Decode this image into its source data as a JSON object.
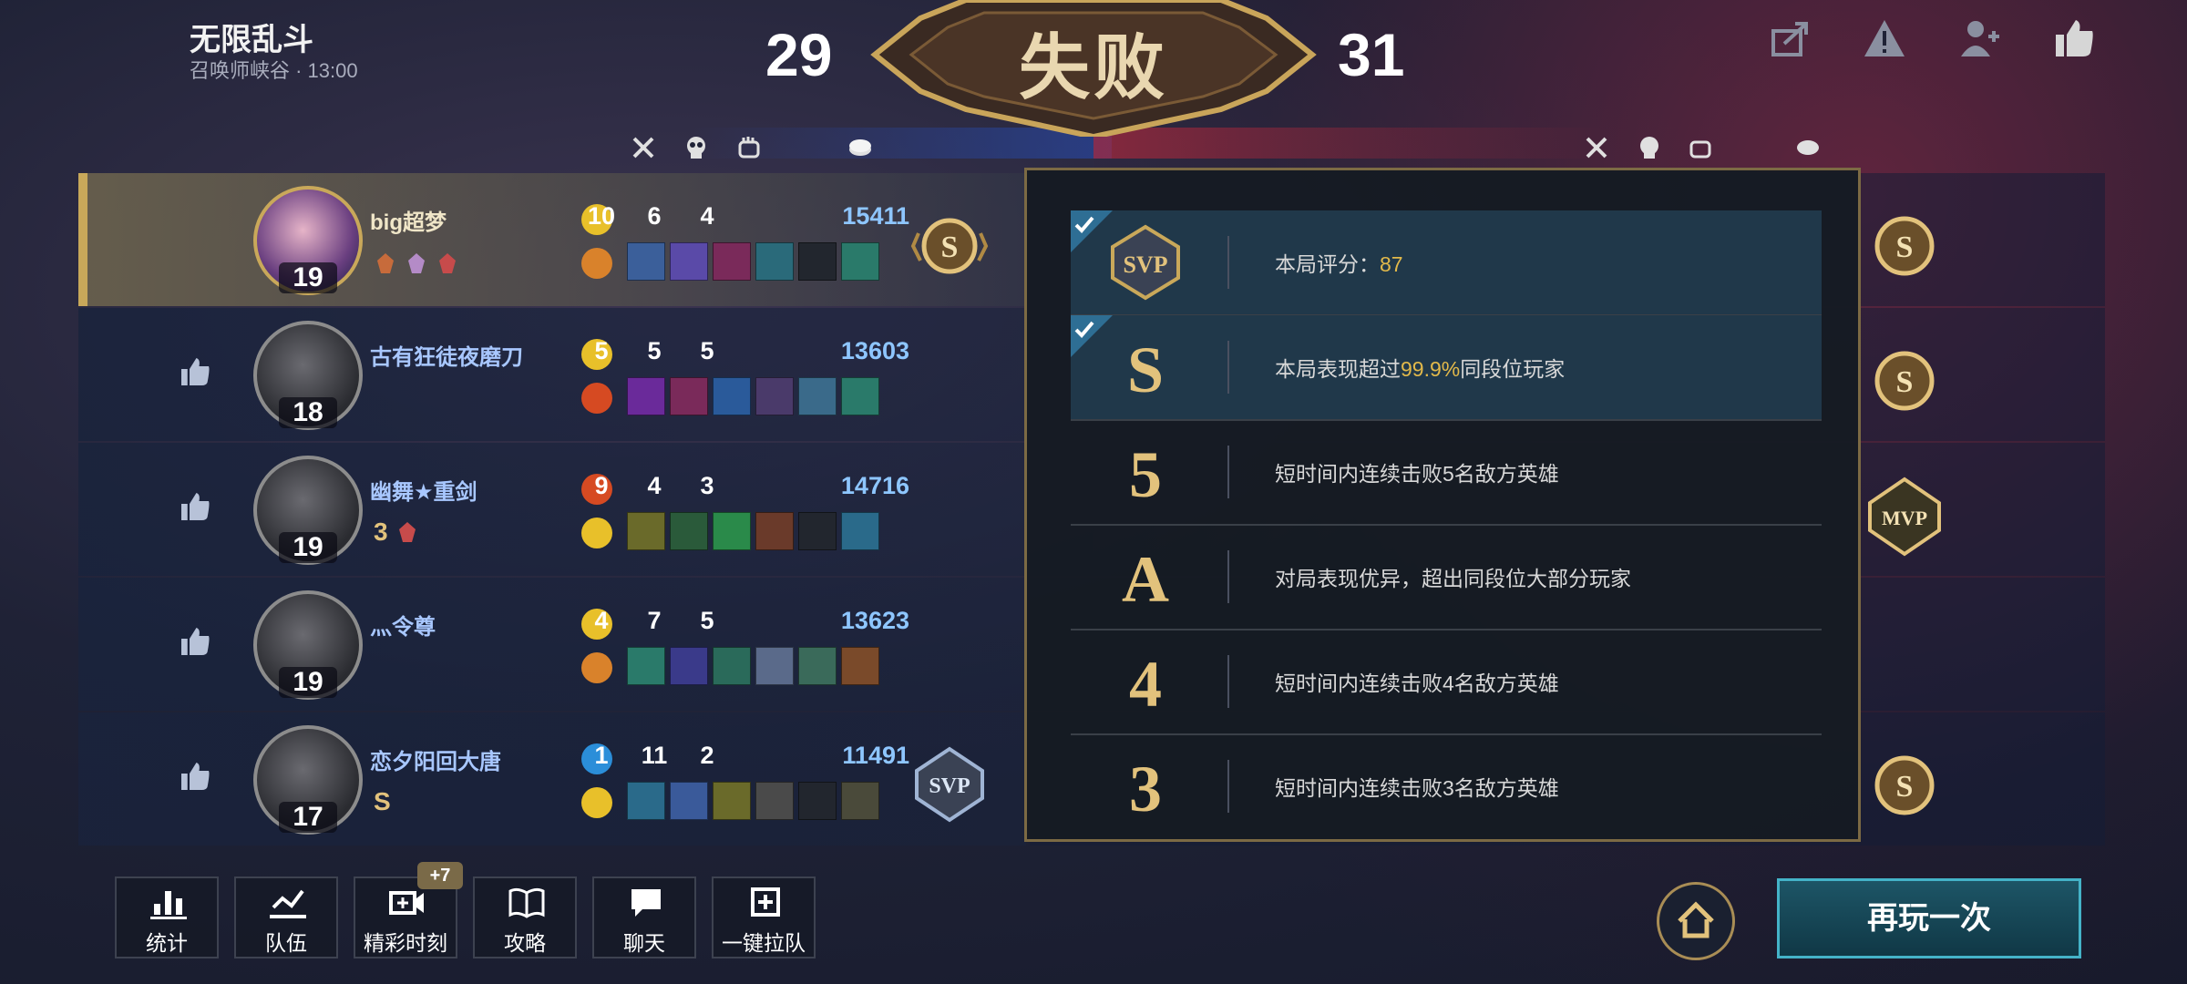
{
  "header": {
    "mode_title": "无限乱斗",
    "mode_sub": "召唤师峡谷 · 13:00",
    "score_left": "29",
    "score_right": "31",
    "result": "失败"
  },
  "top_icons": [
    "share-icon",
    "report-icon",
    "add-friend-icon",
    "thumbs-up-icon"
  ],
  "players": [
    {
      "name": "big超梦",
      "level": "19",
      "kills": "10",
      "deaths": "6",
      "assists": "4",
      "gold": "15411",
      "grade": "S",
      "badge_text": ""
    },
    {
      "name": "古有狂徒夜磨刀",
      "level": "18",
      "kills": "5",
      "deaths": "5",
      "assists": "5",
      "gold": "13603",
      "grade": "",
      "badge_text": ""
    },
    {
      "name": "幽舞★重剑",
      "level": "19",
      "kills": "9",
      "deaths": "4",
      "assists": "3",
      "gold": "14716",
      "grade": "",
      "badge_text": "3"
    },
    {
      "name": "灬令尊",
      "level": "19",
      "kills": "4",
      "deaths": "7",
      "assists": "5",
      "gold": "13623",
      "grade": "",
      "badge_text": ""
    },
    {
      "name": "恋夕阳回大唐",
      "level": "17",
      "kills": "1",
      "deaths": "11",
      "assists": "2",
      "gold": "11491",
      "grade": "SVP",
      "badge_text": "S"
    }
  ],
  "right_grades": [
    "S",
    "S",
    "MVP",
    "",
    "S"
  ],
  "popup": {
    "items": [
      {
        "glyph": "SVP",
        "text_prefix": "本局评分：",
        "highlight": "87",
        "text_suffix": "",
        "active": true
      },
      {
        "glyph": "S",
        "text_prefix": "本局表现超过",
        "highlight": "99.9%",
        "text_suffix": "同段位玩家",
        "active": true
      },
      {
        "glyph": "5",
        "text_prefix": "短时间内连续击败5名敌方英雄",
        "highlight": "",
        "text_suffix": "",
        "active": false
      },
      {
        "glyph": "A",
        "text_prefix": "对局表现优异，超出同段位大部分玩家",
        "highlight": "",
        "text_suffix": "",
        "active": false
      },
      {
        "glyph": "4",
        "text_prefix": "短时间内连续击败4名敌方英雄",
        "highlight": "",
        "text_suffix": "",
        "active": false
      },
      {
        "glyph": "3",
        "text_prefix": "短时间内连续击败3名敌方英雄",
        "highlight": "",
        "text_suffix": "",
        "active": false
      }
    ]
  },
  "bottom": {
    "buttons": [
      "统计",
      "队伍",
      "精彩时刻",
      "攻略",
      "聊天",
      "一键拉队"
    ],
    "highlight_badge": "+7",
    "play_again": "再玩一次"
  },
  "colors": {
    "gold": "#e2b94a",
    "accent_teal": "#44b3c8",
    "gold_text": "#8ec6ff"
  }
}
